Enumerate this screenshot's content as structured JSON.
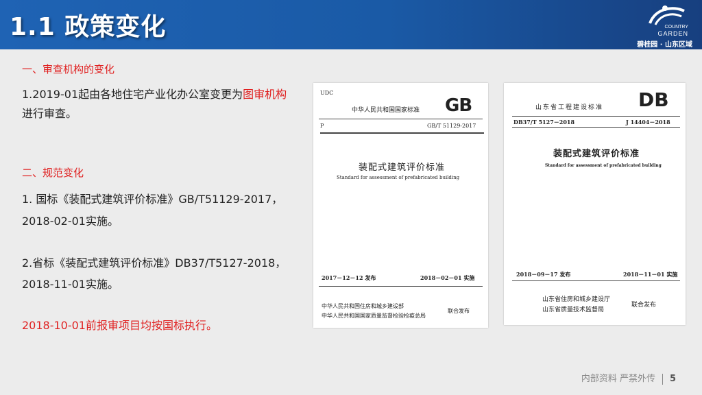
{
  "header": {
    "title": "1.1 政策变化",
    "logo_line1": "COUNTRY",
    "logo_line2": "GARDEN",
    "logo_line3": "碧桂园 · 山东区域"
  },
  "content": {
    "section1_heading": "一、审查机构的变化",
    "section1_text_a": "1.2019-01起由各地住宅产业化办公室变更为",
    "section1_text_red": "图审机构",
    "section1_text_b": "进行审查。",
    "section2_heading": "二、规范变化",
    "item1_line1": "1. 国标《装配式建筑评价标准》GB/T51129-2017，",
    "item1_line2": "2018-02-01实施。",
    "item2_line1": "2.省标《装配式建筑评价标准》DB37/T5127-2018，",
    "item2_line2": "2018-11-01实施。",
    "note": "2018-10-01前报审项目均按国标执行。"
  },
  "doc_gb": {
    "udc": "UDC",
    "issuer_top": "中华人民共和国国家标准",
    "logo": "GB",
    "p": "P",
    "code": "GB/T 51129-2017",
    "title_cn": "装配式建筑评价标准",
    "title_en": "Standard for assessment of prefabricated building",
    "publish_date": "2017－12－12  发布",
    "effective_date": "2018－02－01  实施",
    "issuer1": "中华人民共和国住房和城乡建设部",
    "issuer2": "中华人民共和国国家质量监督检验检疫总局",
    "joint": "联合发布"
  },
  "doc_db": {
    "issuer_top": "山东省工程建设标准",
    "logo": "DB",
    "code_left": "DB37/T 5127－2018",
    "code_right": "J 14404－2018",
    "title_cn": "装配式建筑评价标准",
    "title_en": "Standard for assessment of prefabricated building",
    "publish_date": "2018－09－17 发布",
    "effective_date": "2018－11－01 实施",
    "issuer1": "山东省住房和城乡建设厅",
    "issuer2": "山东省质量技术监督局",
    "joint": "联合发布"
  },
  "footer": {
    "label": "内部资料  严禁外传",
    "page": "5"
  },
  "colors": {
    "header_blue": "#1f63b4",
    "accent_red": "#e02020"
  }
}
